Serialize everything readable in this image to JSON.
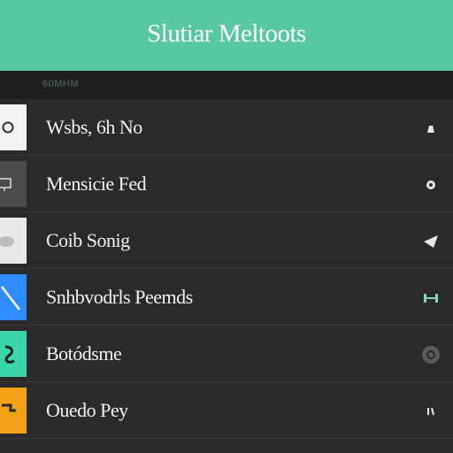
{
  "header": {
    "title": "Slutiar Meltoots",
    "bg_color": "#58c8a0"
  },
  "subheader": {
    "label": "60MHM"
  },
  "rows": [
    {
      "label": "Wsbs, 6h No",
      "icon": "circle-badge-icon",
      "icon_bg": "#f2f2f2",
      "action_icon": "lock-icon"
    },
    {
      "label": "Mensicie Fed",
      "icon": "display-icon",
      "icon_bg": "#4a4a4b",
      "action_icon": "record-icon"
    },
    {
      "label": "Coib Sonig",
      "icon": "cloud-icon",
      "icon_bg": "#e9e9e9",
      "action_icon": "arrow-icon"
    },
    {
      "label": "Snhbvodrls Peemds",
      "icon": "pen-icon",
      "icon_bg": "#2f8cff",
      "action_icon": "ruler-icon"
    },
    {
      "label": "Botódsme",
      "icon": "swirl-icon",
      "icon_bg": "#38d6a8",
      "action_icon": "settings-circle-icon"
    },
    {
      "label": "Ouedo Pey",
      "icon": "spanner-icon",
      "icon_bg": "#f2a216",
      "action_icon": "chevron-icon"
    }
  ]
}
